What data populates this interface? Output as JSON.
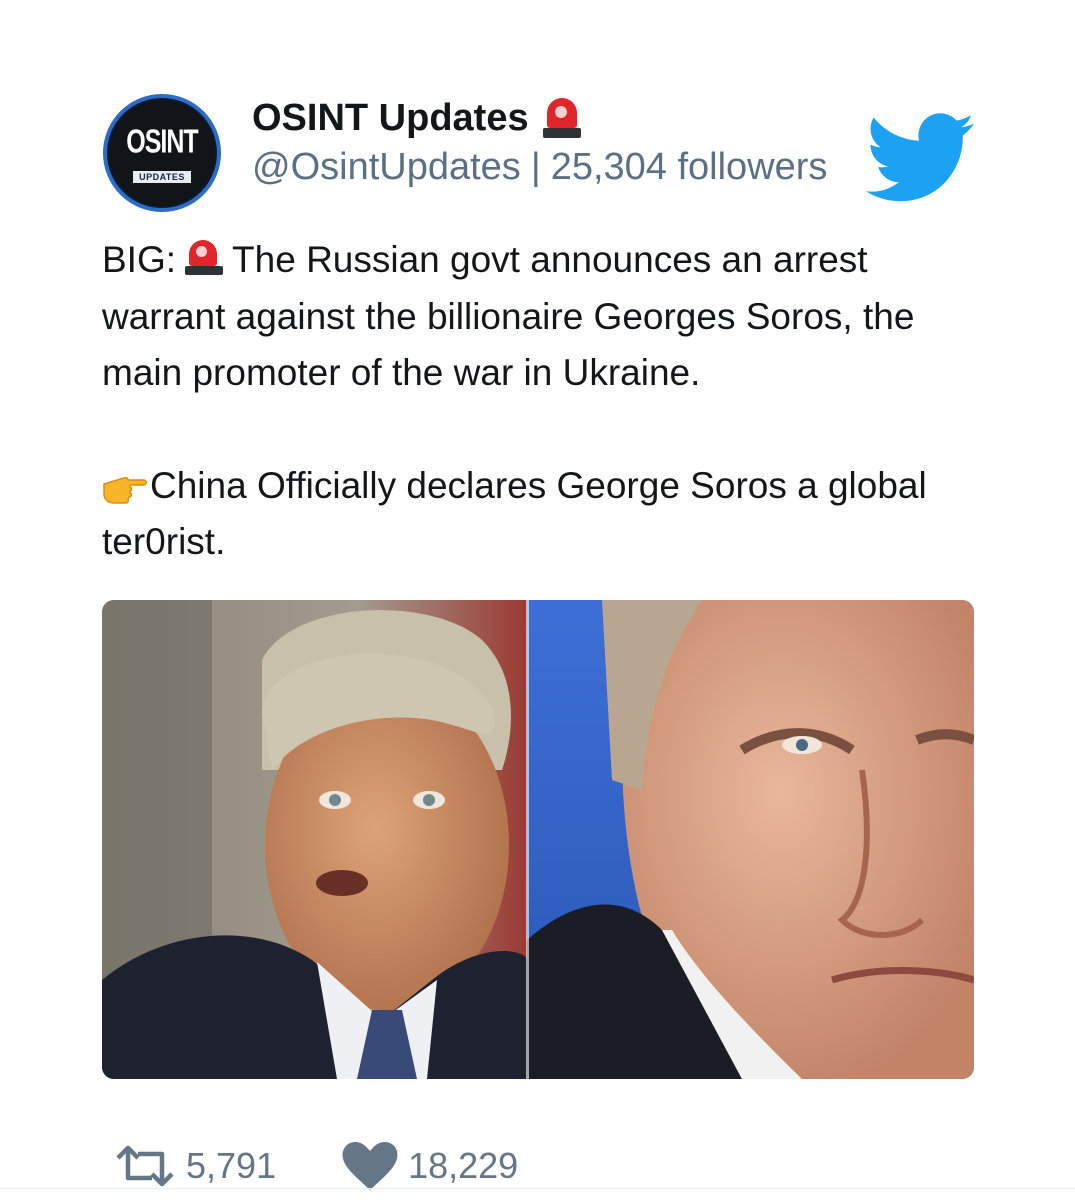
{
  "tweet": {
    "author": {
      "display_name": "OSINT Updates",
      "name_emoji": "rotating-light-emoji",
      "handle": "@OsintUpdates",
      "separator": "|",
      "followers": "25,304 followers",
      "avatar_text": "OSINT",
      "avatar_subtext": "UPDATES"
    },
    "platform_icon": "twitter-bird-icon",
    "text": {
      "p1_prefix": "BIG:",
      "p1_body": "The Russian govt announces an arrest warrant against the billionaire Georges Soros, the main promoter of the war in Ukraine.",
      "p2_body": "China Officially declares George Soros a global ter0rist."
    },
    "stats": {
      "retweets": "5,791",
      "likes": "18,229"
    }
  },
  "colors": {
    "brand_blue": "#1da1f2",
    "text": "#14171a",
    "muted": "#5b7083",
    "siren_red": "#e0262b"
  }
}
